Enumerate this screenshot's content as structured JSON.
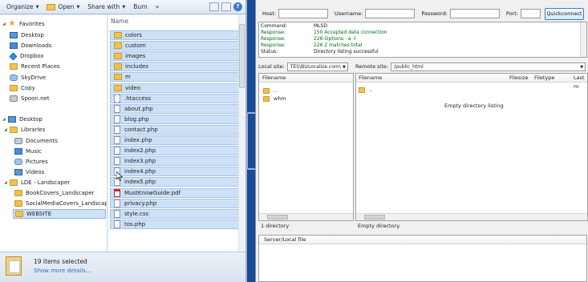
{
  "explorer": {
    "toolbar": {
      "organize": "Organize",
      "open": "Open",
      "share_with": "Share with",
      "burn": "Burn",
      "more": "»"
    },
    "nav": {
      "favorites": "Favorites",
      "desktop_fav": "Desktop",
      "downloads": "Downloads",
      "dropbox": "Dropbox",
      "recent_places": "Recent Places",
      "skydrive": "SkyDrive",
      "copy": "Copy",
      "spoon": "Spoon.net",
      "desktop": "Desktop",
      "libraries": "Libraries",
      "documents": "Documents",
      "music": "Music",
      "pictures": "Pictures",
      "videos": "Videos",
      "lde": "LDE - Landscaper",
      "bookcovers": "BookCovers_Landscaper",
      "socialmedia": "SocialMediaCovers_Landscap",
      "website": "WEBSITE"
    },
    "column_name": "Name",
    "files": [
      "colors",
      "custom",
      "images",
      "includes",
      "m",
      "video",
      ".htaccess",
      "about.php",
      "blog.php",
      "contact.php",
      "index.php",
      "index2.php",
      "index3.php",
      "index4.php",
      "index5.php",
      "MustKnowGuide.pdf",
      "privacy.php",
      "style.css",
      "tos.php"
    ],
    "status": {
      "count": "19 items selected",
      "more": "Show more details..."
    }
  },
  "filezilla": {
    "quickconnect": {
      "host_label": "Host:",
      "username_label": "Username:",
      "password_label": "Password:",
      "port_label": "Port:",
      "button": "Quickconnect"
    },
    "log": [
      {
        "key": "Command:",
        "val": "MLSD"
      },
      {
        "key": "Response:",
        "val": "150 Accepted data connection"
      },
      {
        "key": "Response:",
        "val": "226-Options: -a -l"
      },
      {
        "key": "Response:",
        "val": "226 2 matches total"
      },
      {
        "key": "Status:",
        "val": "Directory listing successful"
      }
    ],
    "local_site_label": "Local site:",
    "local_site_value": "TES\\BizLocalize.com\\",
    "remote_site_label": "Remote site:",
    "remote_site_value": "/public_html",
    "local_header": "Filename",
    "local_items": [
      "..",
      "whm"
    ],
    "remote_headers": {
      "filename": "Filename",
      "filesize": "Filesize",
      "filetype": "Filetype",
      "last": "Last m"
    },
    "remote_items": [
      ".."
    ],
    "empty_listing": "Empty directory listing",
    "local_status": "1 directory",
    "remote_status": "Empty directory.",
    "queue_header": "Server/Local file"
  }
}
